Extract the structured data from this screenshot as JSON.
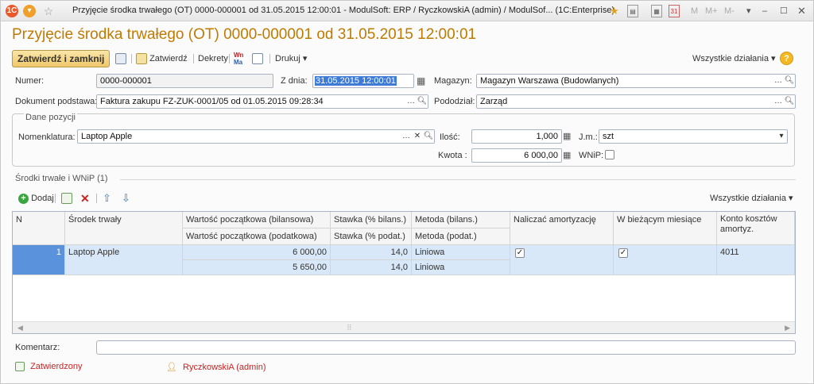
{
  "window": {
    "title": "Przyjęcie środka trwałego (OT) 0000-000001 od 31.05.2015 12:00:01 - ModulSoft: ERP / RyczkowskiA (admin) / ModulSof... (1C:Enterprise)",
    "titlebar_icons_right": [
      "star-icon",
      "doc-icon",
      "calc-icon",
      "calendar-icon"
    ],
    "memory_buttons": [
      "M",
      "M+",
      "M-"
    ]
  },
  "heading": "Przyjęcie środka trwałego (OT) 0000-000001 od 31.05.2015 12:00:01",
  "toolbar": {
    "primary": "Zatwierdź i zamknij",
    "approve": "Zatwierdź",
    "postings": "Dekrety",
    "print": "Drukuj",
    "all_actions": "Wszystkie działania",
    "help": "?"
  },
  "form": {
    "number_label": "Numer:",
    "number_value": "0000-000001",
    "date_label": "Z dnia:",
    "date_value": "31.05.2015 12:00:01",
    "warehouse_label": "Magazyn:",
    "warehouse_value": "Magazyn Warszawa (Budowlanych)",
    "base_doc_label": "Dokument podstawa:",
    "base_doc_value": "Faktura zakupu FZ-ZUK-0001/05 od 01.05.2015 09:28:34",
    "division_label": "Pododział:",
    "division_value": "Zarząd"
  },
  "position": {
    "legend": "Dane pozycji",
    "nomenclature_label": "Nomenklatura:",
    "nomenclature_value": "Laptop Apple",
    "quantity_label": "Ilość:",
    "quantity_value": "1,000",
    "unit_label": "J.m.:",
    "unit_value": "szt",
    "amount_label": "Kwota :",
    "amount_value": "6 000,00",
    "wnip_label": "WNiP:",
    "wnip_checked": false
  },
  "section": {
    "title": "Środki trwałe i  WNiP (1)",
    "add": "Dodaj",
    "all_actions": "Wszystkie działania"
  },
  "table": {
    "headers": {
      "n": "N",
      "asset": "Środek trwały",
      "value_bal": "Wartość początkowa (bilansowa)",
      "value_tax": "Wartość początkowa (podatkowa)",
      "rate_bal": "Stawka (% bilans.)",
      "rate_tax": "Stawka (% podat.)",
      "method_bal": "Metoda (bilans.)",
      "method_tax": "Metoda (podat.)",
      "depreciate": "Naliczać amortyzację",
      "current_month": "W bieżącym miesiące",
      "cost_account": "Konto kosztów",
      "cost_account_2": "amortyz."
    },
    "rows": [
      {
        "n": "1",
        "asset": "Laptop Apple",
        "value_bal": "6 000,00",
        "value_tax": "5 650,00",
        "rate_bal": "14,0",
        "rate_tax": "14,0",
        "method_bal": "Liniowa",
        "method_tax": "Liniowa",
        "depreciate": true,
        "current_month": true,
        "cost_account": "4011"
      }
    ]
  },
  "footer": {
    "comment_label": "Komentarz:",
    "comment_value": "",
    "status": "Zatwierdzony",
    "user": "RyczkowskiA (admin)"
  },
  "colors": {
    "heading": "#c07a00",
    "row_bg": "#d8e8f8",
    "selected_cell": "#5a93db",
    "status_red": "#cc2222"
  }
}
